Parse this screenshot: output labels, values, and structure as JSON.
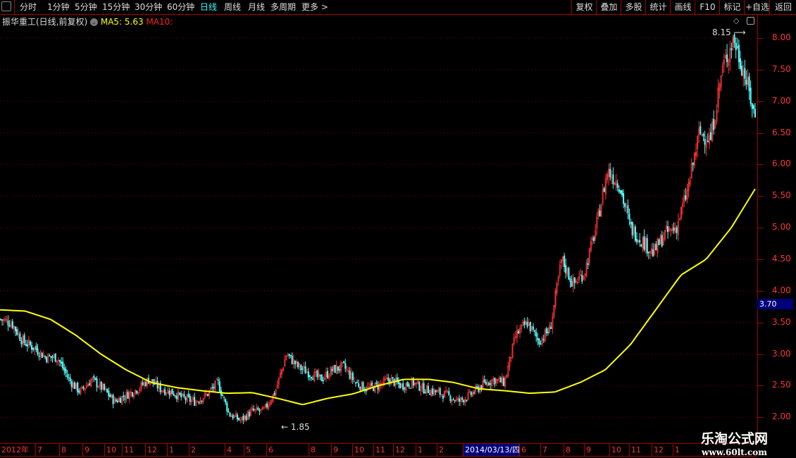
{
  "toolbar": {
    "periods": [
      "分时",
      "1分钟",
      "5分钟",
      "15分钟",
      "30分钟",
      "60分钟",
      "日线",
      "周线",
      "月线",
      "多周期",
      "更多 >"
    ],
    "active": "日线",
    "right_buttons": [
      "复权",
      "叠加",
      "多股",
      "统计",
      "画线",
      "F10",
      "标记",
      "+自选",
      "返回"
    ]
  },
  "header": {
    "title": "振华重工(日线,前复权)",
    "ma5_label": "MA5: 5.63",
    "ma10_label": "MA10:"
  },
  "colors": {
    "up": "#ff3232",
    "down": "#54fcfc",
    "ma": "#ffff00",
    "grid": "#a00000",
    "highlight": "#00007a"
  },
  "chart_data": {
    "type": "candlestick",
    "price_ticks": [
      "8.00",
      "7.50",
      "7.00",
      "6.50",
      "6.00",
      "5.50",
      "5.00",
      "4.50",
      "4.00",
      "3.50",
      "3.00",
      "2.50",
      "2.00"
    ],
    "ylim": [
      1.85,
      8.3
    ],
    "current_price": "3.70",
    "high_annotation": "8.15",
    "low_annotation": "1.85",
    "date_labels": [
      "2012年",
      "7",
      "8",
      "9",
      "10",
      "11",
      "12",
      "1",
      "2",
      "4",
      "5",
      "6",
      "8",
      "9",
      "10",
      "11",
      "12",
      "1",
      "2",
      "2014/03/13/四",
      "6",
      "7",
      "8",
      "9",
      "10",
      "11",
      "12",
      "1"
    ],
    "highlight_date": "2014/03/13/四",
    "close_approx": [
      3.55,
      3.5,
      3.2,
      3.1,
      2.95,
      2.95,
      2.6,
      2.4,
      2.6,
      2.45,
      2.25,
      2.35,
      2.45,
      2.6,
      2.45,
      2.4,
      2.3,
      2.25,
      2.35,
      2.55,
      2.05,
      1.95,
      2.1,
      2.1,
      2.4,
      3.0,
      2.8,
      2.7,
      2.6,
      2.75,
      2.8,
      2.55,
      2.45,
      2.5,
      2.6,
      2.5,
      2.55,
      2.45,
      2.4,
      2.35,
      2.25,
      2.35,
      2.5,
      2.6,
      2.55,
      3.3,
      3.5,
      3.2,
      3.4,
      4.5,
      4.1,
      4.3,
      5.0,
      5.9,
      5.7,
      5.0,
      4.8,
      4.6,
      4.9,
      5.0,
      5.6,
      6.5,
      6.4,
      7.5,
      8.0,
      7.4,
      6.65
    ],
    "ma_approx": [
      3.7,
      3.68,
      3.55,
      3.3,
      3.0,
      2.75,
      2.55,
      2.47,
      2.42,
      2.38,
      2.39,
      2.3,
      2.2,
      2.3,
      2.37,
      2.5,
      2.6,
      2.6,
      2.55,
      2.45,
      2.42,
      2.38,
      2.4,
      2.55,
      2.75,
      3.15,
      3.7,
      4.25,
      4.5,
      5.0,
      5.65
    ]
  },
  "watermark": {
    "name": "乐淘公式网",
    "url": "www.60lt.com"
  }
}
